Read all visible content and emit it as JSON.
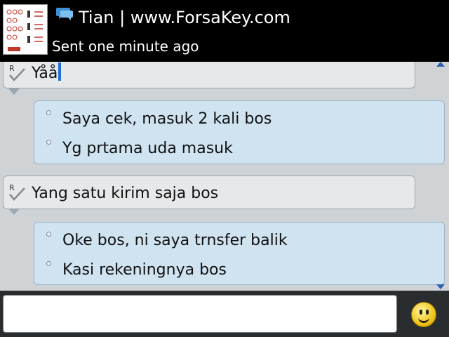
{
  "header": {
    "contact_name": "Tian | www.ForsaKey.com",
    "status": "Sent one minute ago",
    "app_icon": "bbm-chat-icon",
    "avatar": "contact-avatar"
  },
  "messages": [
    {
      "sender": "me",
      "read_mark": "R",
      "lines": [
        "Yåå"
      ]
    },
    {
      "sender": "them",
      "lines": [
        "Saya cek, masuk 2 kali bos",
        "Yg prtama uda masuk"
      ]
    },
    {
      "sender": "me",
      "read_mark": "R",
      "lines": [
        "Yang satu kirim saja bos"
      ]
    },
    {
      "sender": "them",
      "lines": [
        "Oke bos, ni saya trnsfer balik",
        "Kasi rekeningnya bos"
      ]
    }
  ],
  "compose": {
    "value": ""
  },
  "icons": {
    "emoticon": "smiley-icon",
    "scroll_up": "scroll-up-arrow-icon",
    "scroll_down": "scroll-down-arrow-icon"
  },
  "colors": {
    "header_bg": "#000000",
    "chat_bg": "#cfd3d6",
    "incoming_bubble": "#cfe3f1",
    "outgoing_bubble": "#e6e8ea",
    "cursor": "#1f6fd6"
  }
}
